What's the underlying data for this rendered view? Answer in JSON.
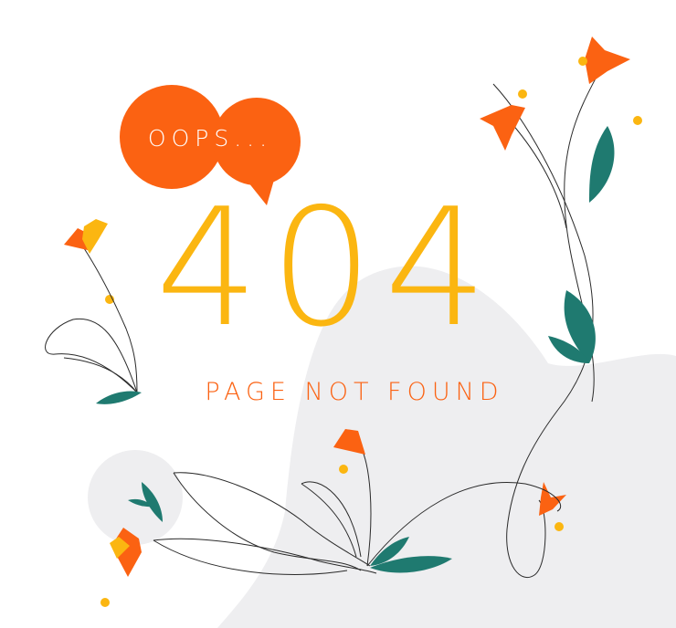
{
  "bubble": {
    "text": "OOPS..."
  },
  "error": {
    "code": "404",
    "message": "PAGE NOT FOUND"
  },
  "colors": {
    "orange": "#FB6212",
    "yellow": "#FBB611",
    "teal": "#1F7A70",
    "blob": "#EEEEF0",
    "line": "#2A2A2A"
  }
}
